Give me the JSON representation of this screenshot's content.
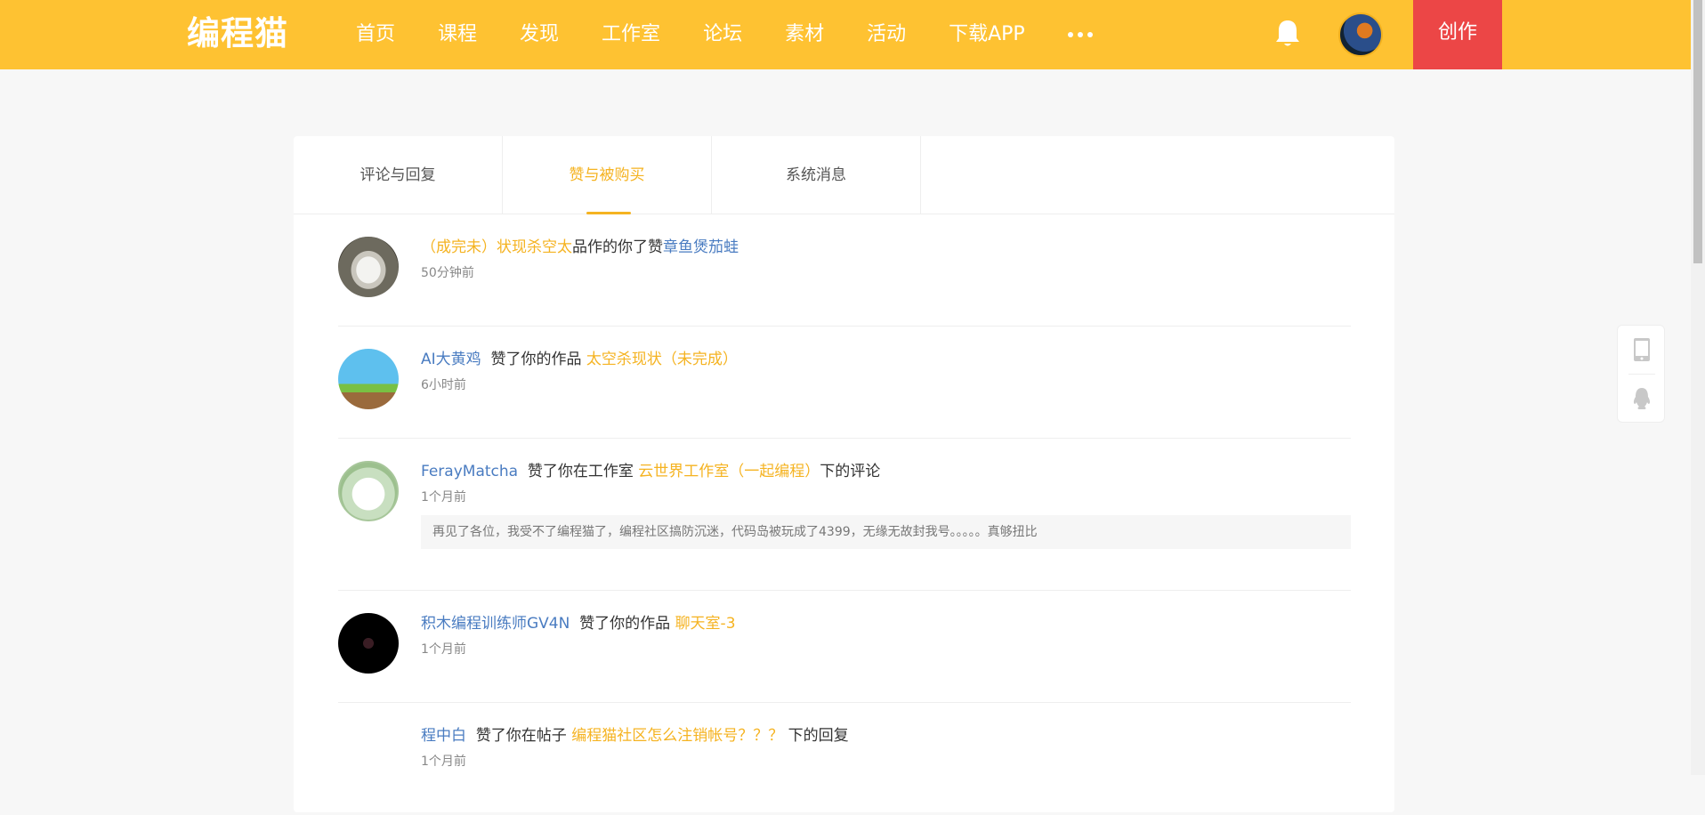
{
  "header": {
    "logo": "编程猫",
    "nav": [
      "首页",
      "课程",
      "发现",
      "工作室",
      "论坛",
      "素材",
      "活动",
      "下载APP"
    ],
    "create_label": "创作",
    "brand_color": "#fec232",
    "create_color": "#ec4646"
  },
  "tabs": {
    "comments": "评论与回复",
    "likes": "赞与被购买",
    "system": "系统消息"
  },
  "messages": [
    {
      "user": "（成完未）状现杀空太",
      "action": "品作的你了赞",
      "target": "章鱼煲茄蛙",
      "suffix": "",
      "time": "50分钟前"
    },
    {
      "user": "AI大黄鸡",
      "action": "赞了你的作品",
      "target": "太空杀现状（未完成）",
      "suffix": "",
      "time": "6小时前"
    },
    {
      "user": "FerayMatcha",
      "action": "赞了你在工作室",
      "target": "云世界工作室（一起编程）",
      "suffix": "下的评论",
      "time": "1个月前",
      "quote": "再见了各位，我受不了编程猫了，编程社区搞防沉迷，代码岛被玩成了4399，无缘无故封我号。。。。。真够扭比"
    },
    {
      "user": "积木编程训练师GV4N",
      "action": "赞了你的作品",
      "target": "聊天室-3",
      "suffix": "",
      "time": "1个月前"
    },
    {
      "user": "程中白",
      "action": "赞了你在帖子",
      "target": "编程猫社区怎么注销帐号？？？",
      "suffix": "下的回复",
      "time": "1个月前"
    }
  ]
}
